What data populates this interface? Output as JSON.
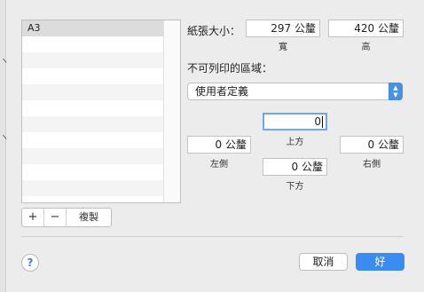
{
  "edge": {
    "glyph1": "ヽ",
    "glyph2": "ヽ"
  },
  "list": {
    "items": [
      "A3",
      "",
      "",
      "",
      "",
      "",
      "",
      "",
      "",
      "",
      "",
      ""
    ],
    "selected_index": 0
  },
  "toolbar": {
    "add_label": "+",
    "remove_label": "−",
    "duplicate_label": "複製"
  },
  "paper_size": {
    "label": "紙張大小：",
    "width_value": "297 公釐",
    "height_value": "420 公釐",
    "width_caption": "寬",
    "height_caption": "高"
  },
  "non_printable": {
    "label": "不可列印的區域：",
    "popup_value": "使用者定義",
    "top_value": "0",
    "top_caption": "上方",
    "left_value": "0 公釐",
    "left_caption": "左側",
    "right_value": "0 公釐",
    "right_caption": "右側",
    "bottom_value": "0 公釐",
    "bottom_caption": "下方"
  },
  "footer": {
    "help_label": "?",
    "cancel_label": "取消",
    "ok_label": "好"
  },
  "colors": {
    "accent": "#3b8cf0",
    "focus_ring": "#6fa7ee",
    "background": "#ececec"
  }
}
